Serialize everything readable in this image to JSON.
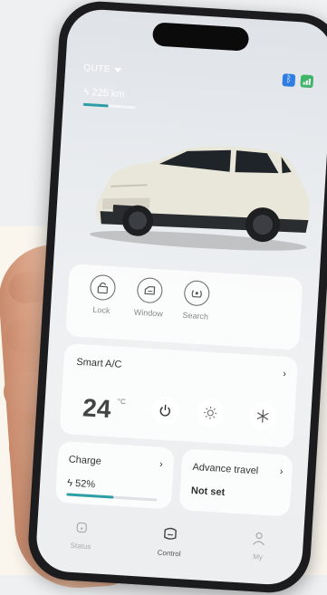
{
  "header": {
    "car_name": "QUTE",
    "range": "225 km",
    "range_level": 0.48
  },
  "quick_actions": [
    {
      "label": "Lock",
      "icon": "lock-icon"
    },
    {
      "label": "Window",
      "icon": "window-icon"
    },
    {
      "label": "Search",
      "icon": "search-car-icon"
    }
  ],
  "ac": {
    "title": "Smart A/C",
    "temperature": "24",
    "unit": "°C",
    "controls": [
      "power-icon",
      "sun-heat-icon",
      "snowflake-icon"
    ]
  },
  "charge": {
    "title": "Charge",
    "value": "52%",
    "level": 0.52
  },
  "advance_travel": {
    "title": "Advance travel",
    "value": "Not set"
  },
  "tabs": [
    {
      "label": "Status",
      "icon": "car-status-icon",
      "active": false
    },
    {
      "label": "Control",
      "icon": "control-icon",
      "active": true
    },
    {
      "label": "My",
      "icon": "user-icon",
      "active": false
    }
  ],
  "colors": {
    "accent": "#2ea0a5",
    "bluetooth": "#2f7de0",
    "signal": "#3fb56a"
  }
}
